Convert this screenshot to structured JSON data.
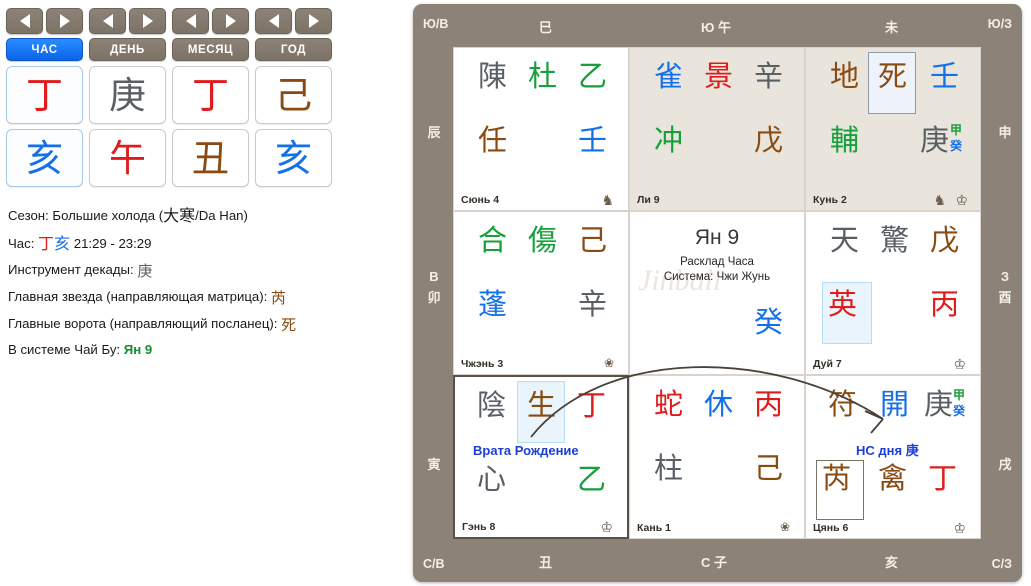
{
  "pillars": {
    "nav_prev_icon": "triangle-left-icon",
    "nav_next_icon": "triangle-right-icon",
    "columns": [
      {
        "tab": "ЧАС",
        "active": true,
        "stem": "丁",
        "branch": "亥"
      },
      {
        "tab": "ДЕНЬ",
        "active": false,
        "stem": "庚",
        "branch": "午"
      },
      {
        "tab": "МЕСЯЦ",
        "active": false,
        "stem": "丁",
        "branch": "丑"
      },
      {
        "tab": "ГОД",
        "active": false,
        "stem": "己",
        "branch": "亥"
      }
    ]
  },
  "info": {
    "season_label": "Сезон: Большие холода (",
    "season_cjk": "大寒",
    "season_tail": "/Da Han)",
    "hour_label": "Час: ",
    "hour_stem": "丁",
    "hour_branch": "亥",
    "hour_range": " 21:29 - 23:29",
    "decade_label": "Инструмент декады: ",
    "decade_value": "庚",
    "star_label": "Главная звезда (направляющая матрица): ",
    "star_value": "芮",
    "gate_label": "Главные ворота (направляющий посланец): ",
    "gate_value": "死",
    "chai_bu_label": "В системе Чай Бу: ",
    "chai_bu_value": "Ян 9"
  },
  "board": {
    "edges": {
      "top_left_corner": "Ю/В",
      "top_1": "巳",
      "top_2": "Ю 午",
      "top_3": "未",
      "top_right_corner": "Ю/З",
      "left_1": "辰",
      "left_2_dir": "В",
      "left_2_br": "卯",
      "left_3": "寅",
      "right_1": "申",
      "right_2_dir": "З",
      "right_2_br": "酉",
      "right_3": "戌",
      "bottom_left_corner": "С/В",
      "bottom_1": "丑",
      "bottom_2": "С 子",
      "bottom_3": "亥",
      "bottom_right_corner": "С/З"
    },
    "center": {
      "title": "Ян 9",
      "sub1": "Расклад Часа",
      "sub2": "Система: Чжи Жунь",
      "stem": "癸",
      "watermark": "Jinbali"
    },
    "cells": [
      {
        "palace": "Сюнь 4",
        "shaded": false,
        "spirit": "陳",
        "gate": "杜",
        "stem": "乙",
        "star": "任",
        "earth": "壬",
        "icons": [
          "horse-icon"
        ]
      },
      {
        "palace": "Ли 9",
        "shaded": true,
        "spirit": "雀",
        "gate": "景",
        "stem": "辛",
        "star": "冲",
        "earth": "戊",
        "icons": []
      },
      {
        "palace": "Кунь 2",
        "shaded": true,
        "spirit": "地",
        "gate": "死",
        "stem": "壬",
        "star": "輔",
        "earth": "庚",
        "earth_sup_top": "甲",
        "earth_sup_bot": "癸",
        "gate_highlight": true,
        "icons": [
          "horse-icon",
          "crown-icon"
        ]
      },
      {
        "palace": "Чжэнь 3",
        "shaded": false,
        "spirit": "合",
        "gate": "傷",
        "stem": "己",
        "star": "蓬",
        "earth": "辛",
        "icons": [
          "flower-icon"
        ]
      },
      {
        "palace": "Дуй 7",
        "shaded": false,
        "spirit": "天",
        "gate": "驚",
        "stem": "戊",
        "star": "英",
        "earth": "丙",
        "star_highlight": true,
        "icons": [
          "crown-icon"
        ]
      },
      {
        "palace": "Гэнь 8",
        "shaded": false,
        "highlight_border": true,
        "spirit": "陰",
        "gate": "生",
        "stem": "丁",
        "star": "心",
        "earth": "乙",
        "gate_highlight": true,
        "tooltip": "Врата Рождение",
        "icons": [
          "crown-icon"
        ]
      },
      {
        "palace": "Кань 1",
        "shaded": false,
        "spirit": "蛇",
        "gate": "休",
        "stem": "丙",
        "star": "柱",
        "earth": "己",
        "icons": [
          "flower-icon"
        ]
      },
      {
        "palace": "Цянь 6",
        "shaded": false,
        "spirit": "符",
        "gate": "開",
        "stem": "庚",
        "stem_sup_top": "甲",
        "stem_sup_bot": "癸",
        "star": "芮",
        "extra": "禽",
        "earth": "丁",
        "star_boxed": true,
        "tooltip": "НС дня 庚",
        "icons": [
          "crown-icon"
        ]
      }
    ],
    "arrow": {
      "name": "flow-arrow",
      "from": "Гэнь 8 生",
      "to": "Цянь 6 庚"
    }
  },
  "colors": {
    "red": "#e01b1b",
    "green": "#15a03a",
    "blue": "#1470e8",
    "brown": "#8a4b12",
    "gray": "#5a5f66",
    "board": "#8d8277",
    "accent_tab": "#0b64e8"
  }
}
